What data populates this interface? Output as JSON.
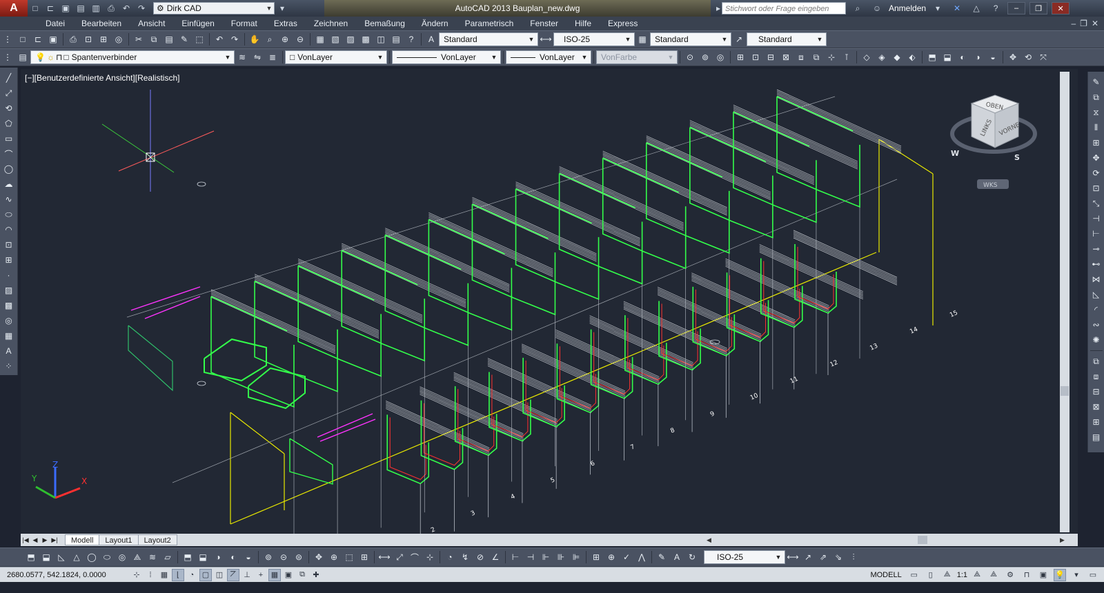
{
  "titlebar": {
    "app_icon": "A",
    "workspace": "Dirk CAD",
    "title": "AutoCAD 2013    Bauplan_new.dwg",
    "search_placeholder": "Stichwort oder Frage eingeben",
    "login": "Anmelden",
    "window_buttons": [
      "minimize-icon",
      "restore-icon",
      "close-icon"
    ]
  },
  "menu": [
    "Datei",
    "Bearbeiten",
    "Ansicht",
    "Einfügen",
    "Format",
    "Extras",
    "Zeichnen",
    "Bemaßung",
    "Ändern",
    "Parametrisch",
    "Fenster",
    "Hilfe",
    "Express"
  ],
  "toolbar1": {
    "text_style": "Standard",
    "dim_style": "ISO-25",
    "table_style": "Standard",
    "mleader_style": "Standard"
  },
  "toolbar2": {
    "layer": "Spantenverbinder",
    "color": "VonLayer",
    "linetype": "VonLayer",
    "lineweight": "VonLayer",
    "plotstyle": "VonFarbe"
  },
  "viewport": {
    "label": "[−][Benutzerdefinierte Ansicht][Realistisch]",
    "viewcube": {
      "top": "OBEN",
      "left": "LINKS",
      "front": "VORNE",
      "compass": [
        "W",
        "S"
      ],
      "ucs": "WKS"
    },
    "station_labels": [
      "2",
      "3",
      "4",
      "5",
      "6",
      "7",
      "8",
      "9",
      "10",
      "11",
      "12",
      "13",
      "14",
      "15"
    ],
    "ucs_axes": [
      "X",
      "Y",
      "Z"
    ],
    "colors": {
      "background": "#222834",
      "frame_green": "#33ff4a",
      "frame_red": "#ff3030",
      "structure_white": "#c8ccd2",
      "baseline_yellow": "#e8e800",
      "magenta": "#ff33ff"
    }
  },
  "layout_tabs": [
    "Modell",
    "Layout1",
    "Layout2"
  ],
  "toolbar3": {
    "dim_style": "ISO-25"
  },
  "statusbar": {
    "coords": "2680.0577, 542.1824, 0.0000",
    "model": "MODELL",
    "annotation_scale": "1:1"
  }
}
